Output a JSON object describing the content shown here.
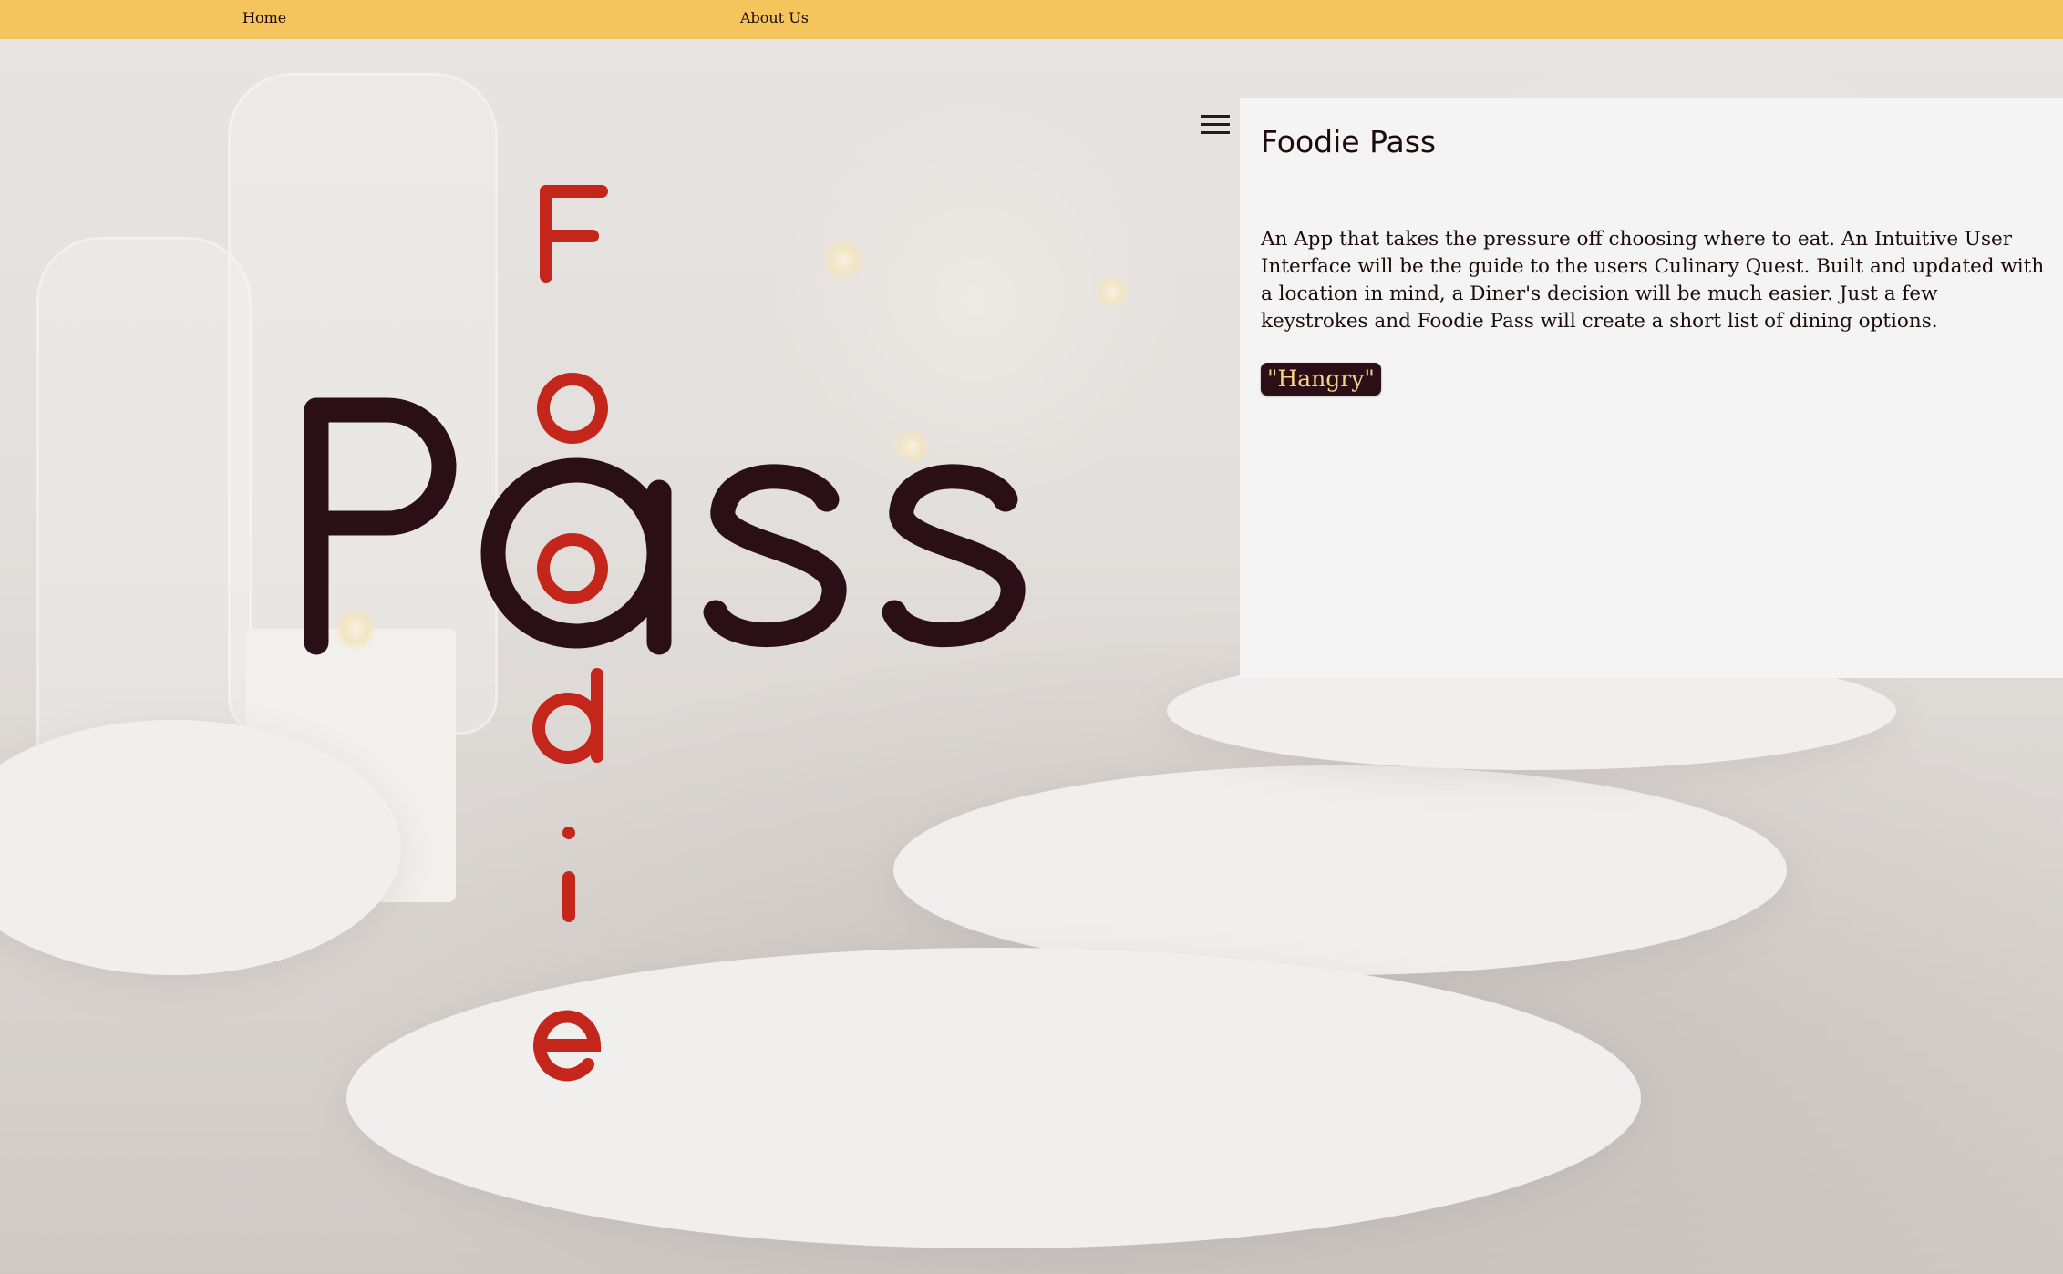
{
  "nav": {
    "home_label": "Home",
    "about_label": "About Us",
    "background_color": "#f3c55c"
  },
  "logo": {
    "primary_word": "Pass",
    "vertical_word": "Foodie",
    "primary_color": "#2a1016",
    "vertical_color": "#c4261b"
  },
  "menu": {
    "icon": "hamburger-menu-icon"
  },
  "panel": {
    "title": "Foodie Pass",
    "description": "An App that takes the pressure off choosing where to eat. An Intuitive User Interface will be the guide to the users Culinary Quest. Built and updated with a location in mind, a Diner's decision will be much easier. Just a few keystrokes and Foodie Pass will create a short list of dining options.",
    "button_label": "\"Hangry\"",
    "button_color": "#2a1016",
    "button_text_color": "#f6d28b"
  }
}
